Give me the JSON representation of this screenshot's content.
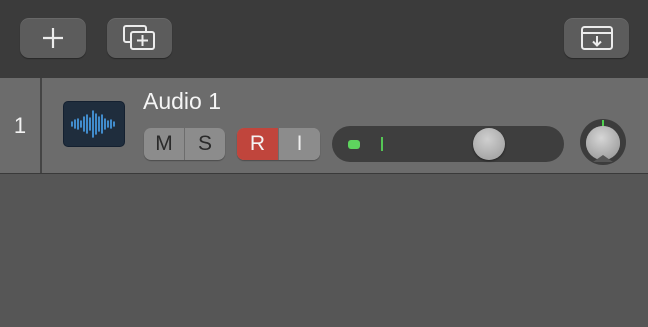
{
  "toolbar": {
    "add_track_icon": "plus-icon",
    "new_track_stack_icon": "stack-plus-icon",
    "download_icon": "download-tray-icon"
  },
  "track": {
    "number": "1",
    "name": "Audio 1",
    "icon": "audio-waveform-icon",
    "mute_label": "M",
    "solo_label": "S",
    "record_label": "R",
    "input_label": "I",
    "volume_fraction": 0.71,
    "pan": 0
  },
  "colors": {
    "record_active": "#c0453c",
    "meter_green": "#5ed45e",
    "waveform_blue": "#4aa3f0"
  }
}
